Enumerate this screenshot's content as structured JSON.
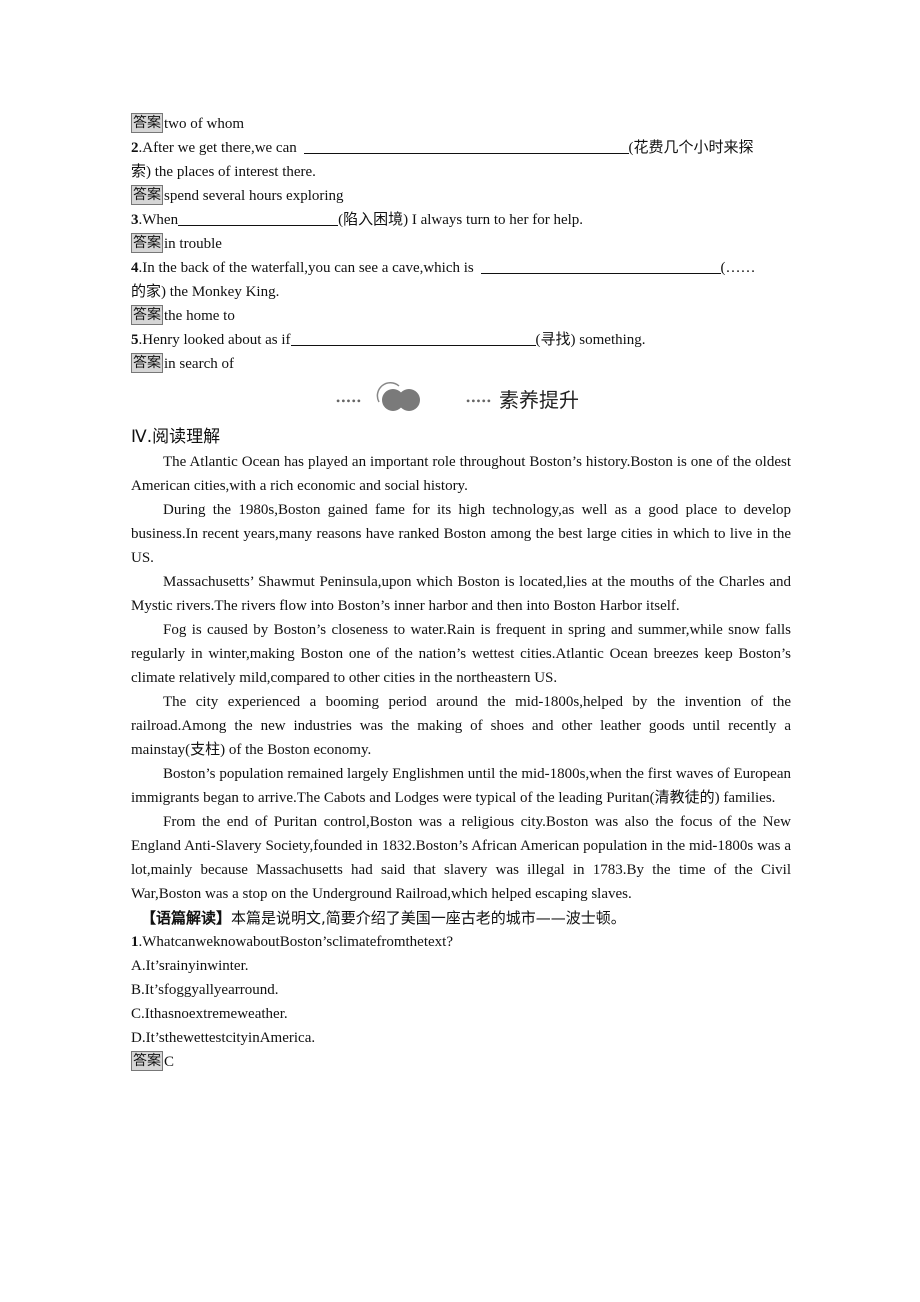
{
  "answer_label": "答案",
  "fill_in": [
    {
      "answer": "two of whom"
    },
    {
      "number": "2",
      "before": ".After we get there,we can ",
      "hint_first": "(花费几个小时来探",
      "hint_rest": "索) the places of interest there.",
      "answer": "spend several hours exploring"
    },
    {
      "number": "3",
      "before": ".When",
      "after": "(陷入困境) I always turn to her for help.",
      "answer": "in trouble"
    },
    {
      "number": "4",
      "before": ".In the back of the waterfall,you can see a cave,which is ",
      "hint_first": "(……",
      "hint_rest": "的家) the Monkey King.",
      "answer": "the home to"
    },
    {
      "number": "5",
      "before": ".Henry looked about as if",
      "after": "(寻找) something.",
      "answer": "in search of"
    }
  ],
  "divider": {
    "dots": "•••••",
    "icon": "double-circle-icon",
    "title": "素养提升"
  },
  "reading": {
    "heading": "Ⅳ.阅读理解",
    "paragraphs": [
      "The Atlantic Ocean has played an important role throughout Boston’s history.Boston is one of the oldest American cities,with a rich economic and social history.",
      "During the 1980s,Boston gained fame for its high technology,as well as a good place to develop business.In recent years,many reasons have ranked Boston among the best large cities in which to live in the US.",
      "Massachusetts’ Shawmut Peninsula,upon which Boston is located,lies at the mouths of the Charles and Mystic rivers.The rivers flow into Boston’s inner harbor and then into Boston Harbor itself.",
      "Fog is caused by Boston’s closeness to water.Rain is frequent in spring and summer,while snow falls regularly in winter,making Boston one of the nation’s wettest cities.Atlantic Ocean breezes keep Boston’s climate relatively mild,compared to other cities in the northeastern US.",
      "The city experienced a booming period around the mid-1800s,helped by the invention of the railroad.Among the new industries was the making of shoes and other leather goods until recently a mainstay(支柱) of the Boston economy.",
      "Boston’s population remained largely Englishmen until the mid-1800s,when the first waves of European immigrants began to arrive.The Cabots and Lodges were typical of the leading Puritan(清教徒的) families.",
      "From the end of Puritan control,Boston was a religious city.Boston was also the focus of the New England Anti-Slavery Society,founded in 1832.Boston’s African American population in the mid-1800s was a lot,mainly because Massachusetts had said that slavery was illegal in 1783.By the time of the Civil War,Boston was a stop on the Underground Railroad,which helped escaping slaves."
    ],
    "note_label": "【语篇解读】",
    "note_text": "本篇是说明文,简要介绍了美国一座古老的城市——波士顿。"
  },
  "question": {
    "number": "1",
    "text": ".WhatcanweknowaboutBoston’sclimatefromthetext?",
    "options": [
      "A.It’srainyinwinter.",
      "B.It’sfoggyallyearround.",
      "C.Ithasnoextremeweather.",
      "D.It’sthewettestcityinAmerica."
    ],
    "answer": "C"
  }
}
